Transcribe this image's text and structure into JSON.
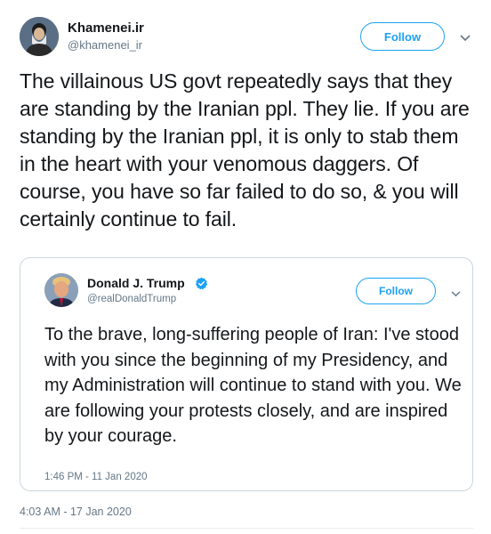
{
  "tweet": {
    "author": {
      "name": "Khamenei.ir",
      "handle": "@khamenei_ir"
    },
    "follow_label": "Follow",
    "text": "The villainous US govt repeatedly says that they are standing by the Iranian ppl. They lie. If you are standing by the Iranian ppl, it is only to stab them in the heart with your venomous daggers. Of course, you have so far failed to do so, & you will certainly continue to fail.",
    "timestamp": "4:03 AM - 17 Jan 2020",
    "menu_icon": "chevron-down-icon"
  },
  "quoted_tweet": {
    "author": {
      "name": "Donald J. Trump",
      "handle": "@realDonaldTrump",
      "verified": true
    },
    "follow_label": "Follow",
    "text": "To the brave, long-suffering people of Iran: I've stood with you since the beginning of my Presidency, and my Administration will continue to stand with you. We are following your protests closely, and are inspired by your courage.",
    "timestamp": "1:46 PM - 11 Jan 2020",
    "menu_icon": "chevron-down-icon"
  },
  "colors": {
    "accent": "#1da1f2",
    "text": "#14171a",
    "secondary_text": "#657786",
    "border": "#ccd6dd"
  }
}
